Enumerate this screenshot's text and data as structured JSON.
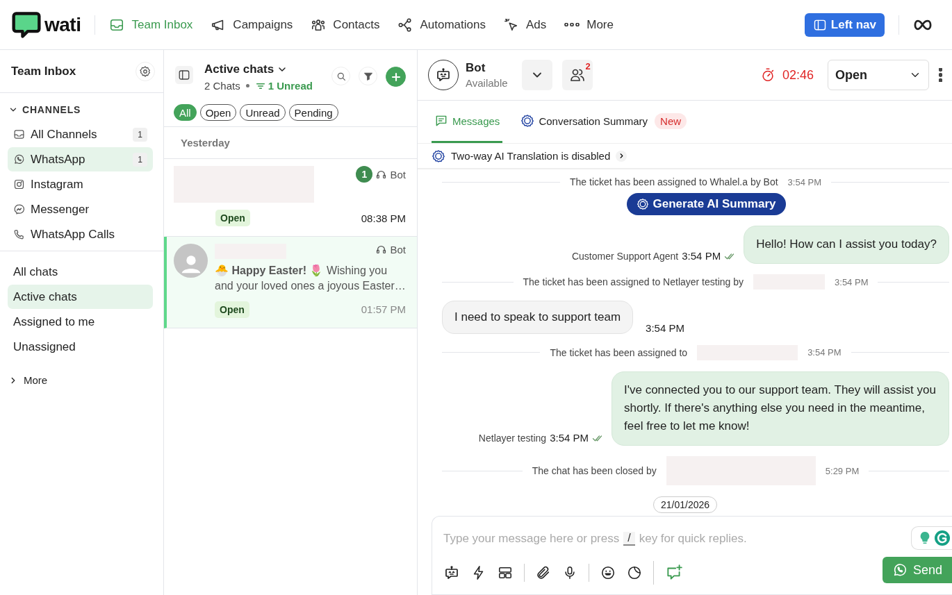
{
  "top_nav": {
    "logo_text": "wati",
    "items": [
      {
        "label": "Team Inbox",
        "selected": true
      },
      {
        "label": "Campaigns",
        "selected": false
      },
      {
        "label": "Contacts",
        "selected": false
      },
      {
        "label": "Automations",
        "selected": false
      },
      {
        "label": "Ads",
        "selected": false
      },
      {
        "label": "More",
        "selected": false
      }
    ],
    "left_nav_button": "Left nav"
  },
  "sidebar": {
    "title": "Team Inbox",
    "channels_heading": "CHANNELS",
    "channels_expanded": true,
    "channels": [
      {
        "label": "All Channels",
        "count": "1",
        "selected": false
      },
      {
        "label": "WhatsApp",
        "count": "1",
        "selected": true
      },
      {
        "label": "Instagram",
        "selected": false
      },
      {
        "label": "Messenger",
        "selected": false
      },
      {
        "label": "WhatsApp Calls",
        "selected": false
      }
    ],
    "views": [
      {
        "label": "All chats",
        "selected": false
      },
      {
        "label": "Active chats",
        "selected": true
      },
      {
        "label": "Assigned to me",
        "selected": false
      },
      {
        "label": "Unassigned",
        "selected": false
      }
    ],
    "more": {
      "label": "More",
      "expanded": false
    }
  },
  "chat_list": {
    "title": "Active chats",
    "count": "2 Chats",
    "unread": "1 Unread",
    "filters": [
      {
        "label": "All",
        "selected": true
      },
      {
        "label": "Open",
        "selected": false
      },
      {
        "label": "Unread",
        "selected": false
      },
      {
        "label": "Pending",
        "selected": false
      }
    ],
    "section": "Yesterday",
    "chats": [
      {
        "agent": "Bot",
        "unread": "1",
        "status": "Open",
        "time": "08:38 PM",
        "selected": false
      },
      {
        "agent": "Bot",
        "preview": "🐣 **Happy Easter!** 🌷 Wishing you and your loved ones a joyous Easter…",
        "status": "Open",
        "time": "01:57 PM",
        "selected": true
      }
    ]
  },
  "conversation": {
    "contact": "Bot",
    "presence": "Available",
    "agents_badge": "2",
    "timer": "02:46",
    "status": "Open",
    "tabs": [
      {
        "label": "Messages",
        "selected": true
      },
      {
        "label": "Conversation Summary",
        "badge": "New",
        "selected": false
      }
    ],
    "translation": "Two-way AI Translation is disabled",
    "ai_button": "Generate AI Summary",
    "messages": [
      {
        "kind": "system",
        "text": "The ticket has been assigned to Whalel.a by Bot",
        "redacted": false,
        "time": "3:54 PM"
      },
      {
        "kind": "ai"
      },
      {
        "kind": "outgoing",
        "text": "Hello! How can I assist you today?",
        "sender": "Customer Support Agent",
        "time": "3:54 PM"
      },
      {
        "kind": "system",
        "text": "The ticket has been assigned to Netlayer testing by",
        "redacted": true,
        "time": "3:54 PM"
      },
      {
        "kind": "incoming",
        "text": "I need to speak to support team",
        "time": "3:54 PM"
      },
      {
        "kind": "system",
        "text": "The ticket has been assigned to",
        "redacted": true,
        "time": "3:54 PM"
      },
      {
        "kind": "outgoing",
        "text": "I've connected you to our support team. They will assist you shortly. If there's anything else you need in the meantime, feel free to let me know!",
        "sender": "Netlayer testing",
        "time": "3:54 PM"
      },
      {
        "kind": "system",
        "text": "The chat has been closed by",
        "redacted": true,
        "time": "5:29 PM"
      },
      {
        "kind": "date",
        "text": "21/01/2026"
      }
    ],
    "composer": {
      "placeholder_start": "Type your message here or press",
      "shortcut_key": "/",
      "placeholder_end": "key for quick replies.",
      "send": "Send"
    }
  }
}
